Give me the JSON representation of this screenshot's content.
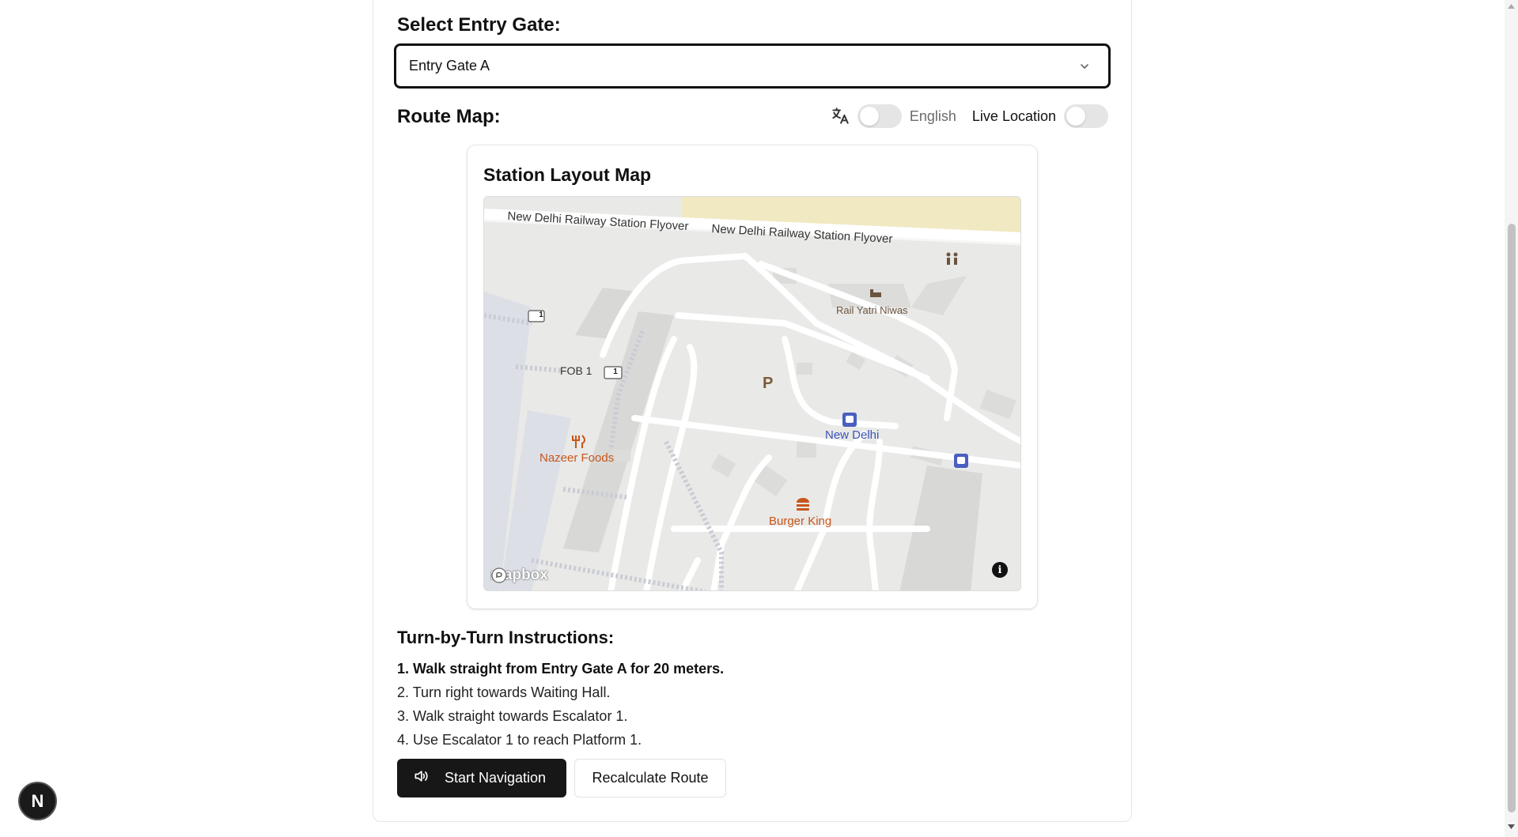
{
  "entry": {
    "label": "Select Entry Gate:",
    "selected": "Entry Gate A"
  },
  "route": {
    "label": "Route Map:",
    "language_label": "English",
    "live_location_label": "Live Location",
    "language_toggle_on": false,
    "live_location_on": false
  },
  "map": {
    "title": "Station Layout Map",
    "labels": {
      "flyover_1": "New Delhi Railway Station Flyover",
      "flyover_2": "New Delhi Railway Station Flyover",
      "fob": "FOB 1",
      "route_shield_1": "1",
      "route_shield_2": "1",
      "rail_yatri": "Rail Yatri Niwas",
      "parking": "P",
      "new_delhi": "New Delhi",
      "nazeer": "Nazeer Foods",
      "burger_king": "Burger King"
    },
    "attribution": "mapbox",
    "info": "i"
  },
  "instructions": {
    "title": "Turn-by-Turn Instructions:",
    "steps": [
      "1. Walk straight from Entry Gate A for 20 meters.",
      "2. Turn right towards Waiting Hall.",
      "3. Walk straight towards Escalator 1.",
      "4. Use Escalator 1 to reach Platform 1."
    ]
  },
  "actions": {
    "start": "Start Navigation",
    "recalculate": "Recalculate Route"
  },
  "badge": {
    "letter": "N"
  },
  "icons": {
    "select_chevron": "chevron-down-icon",
    "translate": "translate-icon",
    "speaker": "speaker-icon",
    "info": "info-icon"
  },
  "colors": {
    "primary": "#171717",
    "poi_orange": "#c8561b",
    "poi_blue": "#3b55b5"
  }
}
